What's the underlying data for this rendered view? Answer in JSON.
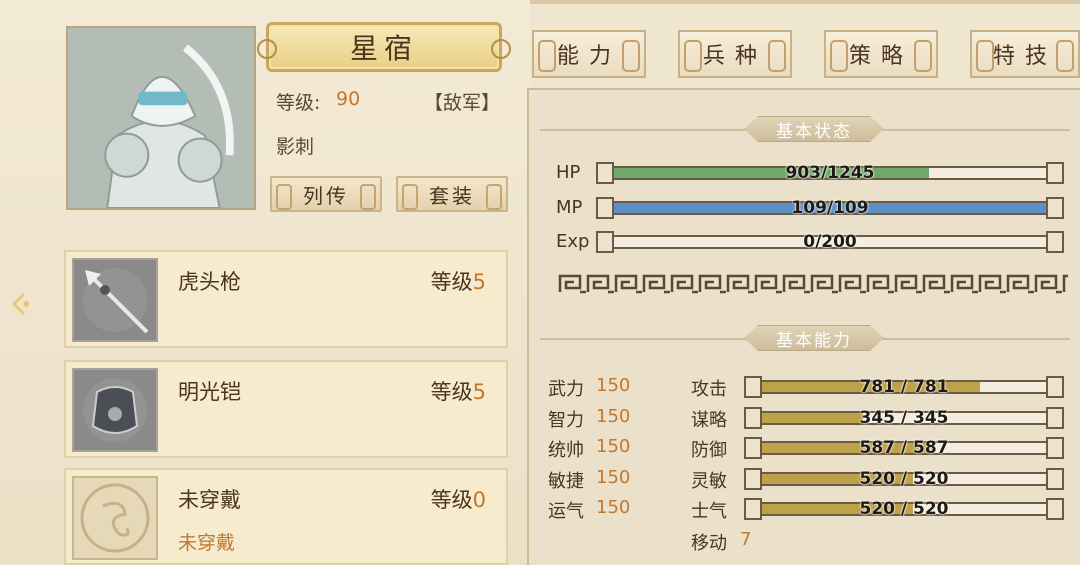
{
  "character": {
    "name": "星宿",
    "level_label": "等级:",
    "level_value": "90",
    "faction": "【敌军】",
    "class": "影刺",
    "buttons": [
      "列传",
      "套装"
    ]
  },
  "tabs": [
    "能力",
    "兵种",
    "策略",
    "特技"
  ],
  "equipment": [
    {
      "name": "虎头枪",
      "level_label": "等级",
      "level": "5",
      "status": "",
      "icon": "spear-icon"
    },
    {
      "name": "明光铠",
      "level_label": "等级",
      "level": "5",
      "status": "",
      "icon": "armor-icon"
    },
    {
      "name": "未穿戴",
      "level_label": "等级",
      "level": "0",
      "status": "未穿戴",
      "icon": "dragon-emblem-icon"
    }
  ],
  "basic_status": {
    "title": "基本状态",
    "bars": [
      {
        "label": "HP",
        "text": "903/1245",
        "fraction": 0.725,
        "color": "#6fa86a"
      },
      {
        "label": "MP",
        "text": "109/109",
        "fraction": 1.0,
        "color": "#5b8fc6"
      },
      {
        "label": "Exp",
        "text": "0/200",
        "fraction": 0.0,
        "color": "#b49a4c"
      }
    ]
  },
  "basic_ability": {
    "title": "基本能力",
    "attributes": [
      {
        "label": "武力",
        "value": "150"
      },
      {
        "label": "智力",
        "value": "150"
      },
      {
        "label": "统帅",
        "value": "150"
      },
      {
        "label": "敏捷",
        "value": "150"
      },
      {
        "label": "运气",
        "value": "150"
      }
    ],
    "combat": [
      {
        "label": "攻击",
        "text": "781 / 781",
        "fraction": 0.76
      },
      {
        "label": "谋略",
        "text": "345 / 345",
        "fraction": 0.36
      },
      {
        "label": "防御",
        "text": "587 / 587",
        "fraction": 0.6
      },
      {
        "label": "灵敏",
        "text": "520 / 520",
        "fraction": 0.53
      },
      {
        "label": "士气",
        "text": "520 / 520",
        "fraction": 0.53
      }
    ],
    "move_label": "移动",
    "move_value": "7"
  },
  "colors": {
    "accent": "#c0782f",
    "bar_gold": "#bda24a"
  }
}
